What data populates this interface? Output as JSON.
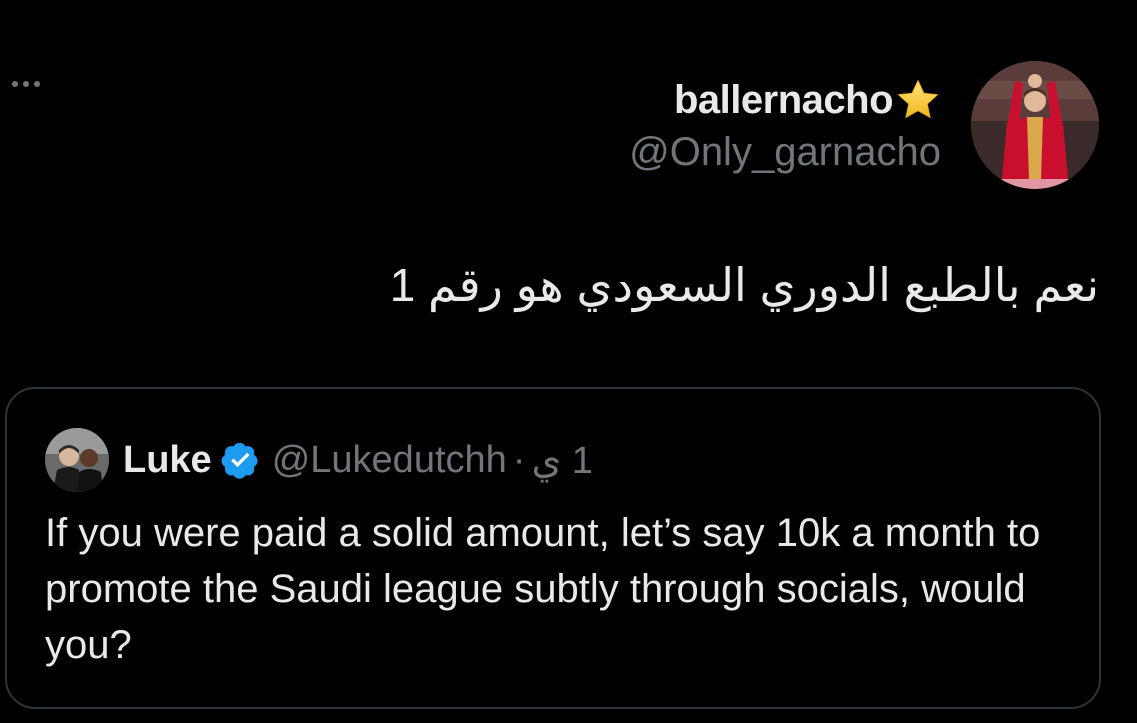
{
  "author": {
    "display_name": "ballernacho",
    "handle": "@Only_garnacho",
    "badge_icon": "star-icon",
    "avatar_icon": "user-avatar"
  },
  "tweet": {
    "text": "نعم بالطبع الدوري السعودي هو رقم 1"
  },
  "quoted_tweet": {
    "author_name": "Luke",
    "verified_icon": "verified-badge-icon",
    "verified_color": "#1d9bf0",
    "handle": "@Lukedutchh",
    "separator": "·",
    "time": "1 ي",
    "text": "If you were paid a solid amount, let’s say 10k a month to promote the Saudi league subtly through socials, would you?"
  },
  "colors": {
    "background": "#000000",
    "primary_text": "#e7e9ea",
    "secondary_text": "#71767b",
    "border": "#2f3336",
    "star": "#f5c518"
  },
  "menu": {
    "more_icon": "more-icon"
  }
}
